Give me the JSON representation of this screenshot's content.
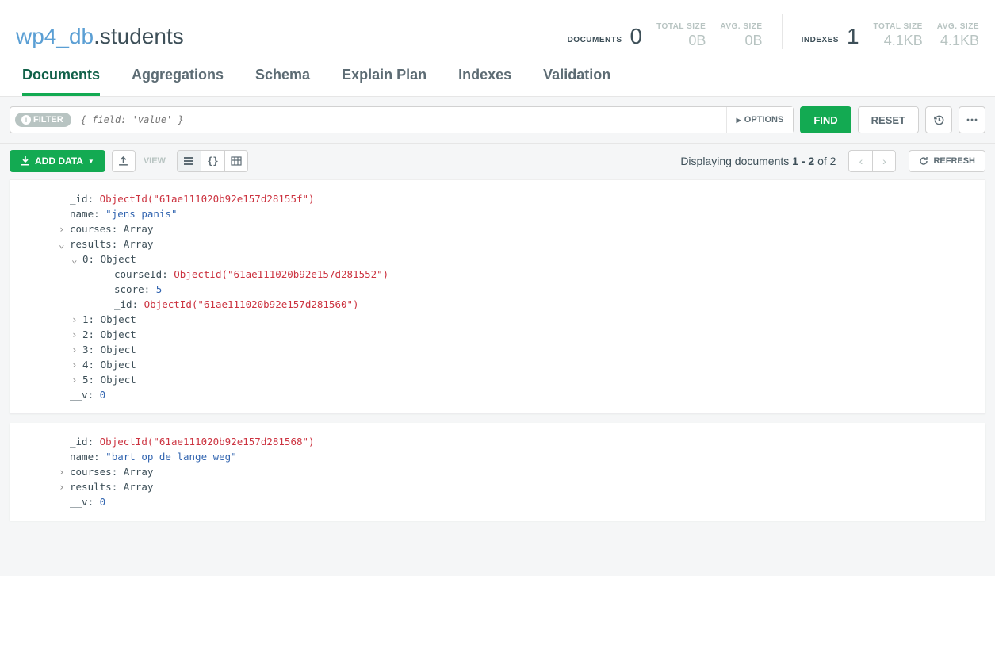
{
  "header": {
    "database": "wp4_db",
    "collection": ".students",
    "docs_label": "DOCUMENTS",
    "docs_count": "0",
    "docs_total_size_label": "TOTAL SIZE",
    "docs_total_size": "0B",
    "docs_avg_size_label": "AVG. SIZE",
    "docs_avg_size": "0B",
    "idx_label": "INDEXES",
    "idx_count": "1",
    "idx_total_size_label": "TOTAL SIZE",
    "idx_total_size": "4.1KB",
    "idx_avg_size_label": "AVG. SIZE",
    "idx_avg_size": "4.1KB"
  },
  "tabs": {
    "documents": "Documents",
    "aggregations": "Aggregations",
    "schema": "Schema",
    "explain": "Explain Plan",
    "indexes": "Indexes",
    "validation": "Validation"
  },
  "query": {
    "filter_badge": "FILTER",
    "placeholder": "{ field: 'value' }",
    "options": "OPTIONS",
    "find": "FIND",
    "reset": "RESET"
  },
  "toolbar": {
    "add_data": "ADD DATA",
    "view_label": "VIEW",
    "display_prefix": "Displaying documents ",
    "display_range": "1 - 2",
    "display_of": " of 2",
    "refresh": "REFRESH"
  },
  "docs": [
    {
      "rows": [
        {
          "indent": 0,
          "key": "_id",
          "valType": "str",
          "val": "ObjectId(\"61ae111020b92e157d28155f\")"
        },
        {
          "indent": 0,
          "key": "name",
          "valType": "blue",
          "val": "\"jens panis\""
        },
        {
          "indent": 0,
          "expand": ">",
          "key": "courses",
          "valType": "type",
          "val": "Array"
        },
        {
          "indent": 0,
          "expand": "v",
          "key": "results",
          "valType": "type",
          "val": "Array"
        },
        {
          "indent": 1,
          "expand": "v",
          "key": "0",
          "valType": "type",
          "val": "Object"
        },
        {
          "indent": 3,
          "key": "courseId",
          "valType": "str",
          "val": "ObjectId(\"61ae111020b92e157d281552\")"
        },
        {
          "indent": 3,
          "key": "score",
          "valType": "num",
          "val": "5"
        },
        {
          "indent": 3,
          "key": "_id",
          "valType": "str",
          "val": "ObjectId(\"61ae111020b92e157d281560\")"
        },
        {
          "indent": 1,
          "expand": ">",
          "key": "1",
          "valType": "type",
          "val": "Object"
        },
        {
          "indent": 1,
          "expand": ">",
          "key": "2",
          "valType": "type",
          "val": "Object"
        },
        {
          "indent": 1,
          "expand": ">",
          "key": "3",
          "valType": "type",
          "val": "Object"
        },
        {
          "indent": 1,
          "expand": ">",
          "key": "4",
          "valType": "type",
          "val": "Object"
        },
        {
          "indent": 1,
          "expand": ">",
          "key": "5",
          "valType": "type",
          "val": "Object"
        },
        {
          "indent": 0,
          "key": "__v",
          "valType": "num",
          "val": "0"
        }
      ]
    },
    {
      "rows": [
        {
          "indent": 0,
          "key": "_id",
          "valType": "str",
          "val": "ObjectId(\"61ae111020b92e157d281568\")"
        },
        {
          "indent": 0,
          "key": "name",
          "valType": "blue",
          "val": "\"bart op de lange weg\""
        },
        {
          "indent": 0,
          "expand": ">",
          "key": "courses",
          "valType": "type",
          "val": "Array"
        },
        {
          "indent": 0,
          "expand": ">",
          "key": "results",
          "valType": "type",
          "val": "Array"
        },
        {
          "indent": 0,
          "key": "__v",
          "valType": "num",
          "val": "0"
        }
      ]
    }
  ]
}
